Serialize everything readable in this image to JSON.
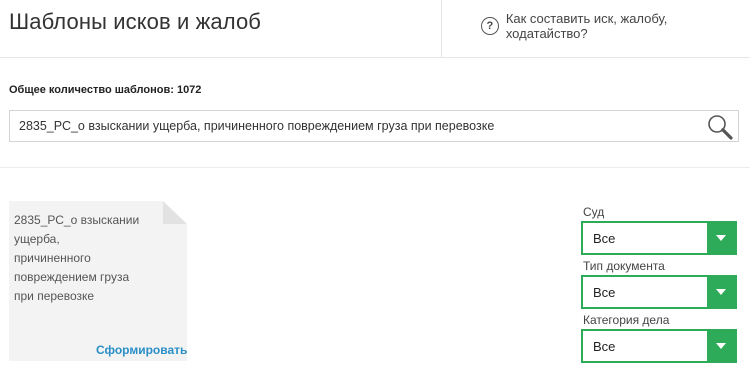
{
  "header": {
    "title": "Шаблоны исков и жалоб",
    "help_icon": "question-circle-icon",
    "help_text": "Как составить иск, жалобу, ходатайство?"
  },
  "summary": {
    "count_label": "Общее количество шаблонов: 1072"
  },
  "search": {
    "value": "2835_РС_о взыскании ущерба, причиненного повреждением груза при перевозке",
    "icon": "search-icon"
  },
  "results": [
    {
      "title_lines": [
        "2835_РС_о взыскании",
        "ущерба,",
        "причиненного",
        "повреждением груза",
        "при перевозке"
      ],
      "action": "Сформировать"
    }
  ],
  "filters": [
    {
      "label": "Суд",
      "value": "Все"
    },
    {
      "label": "Тип документа",
      "value": "Все"
    },
    {
      "label": "Категория дела",
      "value": "Все"
    }
  ],
  "colors": {
    "accent_green": "#2eab59",
    "link_blue": "#2a8fc7"
  }
}
